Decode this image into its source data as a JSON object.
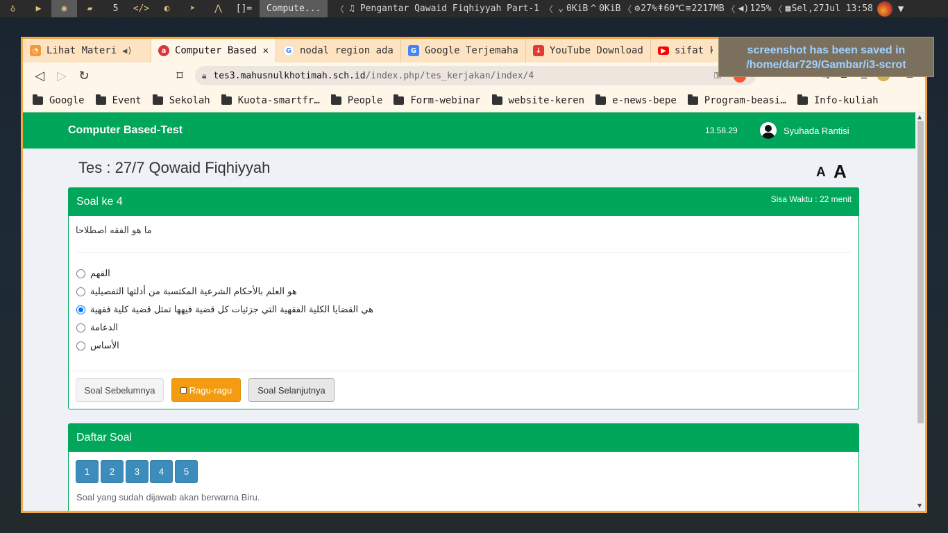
{
  "topbar": {
    "workspaces": [
      "5"
    ],
    "window_title": "Compute...",
    "media": "Pengantar Qawaid Fiqhiyyah Part-1",
    "net_down": "0KiB",
    "net_up": "0KiB",
    "cpu": "27%",
    "temp": "60℃",
    "mem": "2217MB",
    "volume": "125%",
    "date": "Sel,27Jul 13:58",
    "icons": [
      "bell-icon",
      "play-icon",
      "browser-icon",
      "folder-icon",
      "code-icon",
      "firefox-icon",
      "telegram-icon",
      "inkscape-icon",
      "terminal-icon"
    ]
  },
  "tabs": [
    {
      "label": "Lihat Materi",
      "favicon": "#f29a38",
      "audio": true
    },
    {
      "label": "Computer Based-Test",
      "favicon": "#d9363e",
      "active": true
    },
    {
      "label": "nodal region adalah",
      "favicon": "#4285f4"
    },
    {
      "label": "Google Terjemahan",
      "favicon": "#4285f4"
    },
    {
      "label": "YouTube Downloader",
      "favicon": "#e53935"
    },
    {
      "label": "sifat ko",
      "favicon": "#ff0000"
    }
  ],
  "url": {
    "host": "tes3.mahusnulkhotimah.sch.id",
    "path": "/index.php/tes_kerjakan/index/4"
  },
  "bookmarks": [
    "Google",
    "Event",
    "Sekolah",
    "Kuota-smartfr…",
    "People",
    "Form-webinar",
    "website-keren",
    "e-news-bepe",
    "Program-beasi…",
    "Info-kuliah"
  ],
  "app": {
    "brand": "Computer Based-Test",
    "clock": "13.58.29",
    "user": "Syuhada Rantisi"
  },
  "test": {
    "title": "Tes : 27/7 Qowaid Fiqhiyyah",
    "font_small": "A",
    "font_large": "A"
  },
  "question": {
    "heading": "Soal ke 4",
    "timer": "Sisa Waktu : 22 menit",
    "text": "ما هو الفقه اصطلاحا",
    "options": [
      {
        "label": "الفهم",
        "checked": false
      },
      {
        "label": "هو العلم بالأحكام الشرعية المكتسبة من أدلتها التفصيلية",
        "checked": false
      },
      {
        "label": "هي القضايا الكلية الفقهية التي جزئيات كل قضية فيهها تمثل قضية كلية فقهية",
        "checked": true
      },
      {
        "label": "الدعامة",
        "checked": false
      },
      {
        "label": "الأساس",
        "checked": false
      }
    ],
    "buttons": {
      "prev": "Soal Sebelumnya",
      "doubt": "Ragu-ragu",
      "next": "Soal Selanjutnya"
    }
  },
  "question_list": {
    "heading": "Daftar Soal",
    "numbers": [
      "1",
      "2",
      "3",
      "4",
      "5"
    ],
    "note": "Soal yang sudah dijawab akan berwarna Biru."
  },
  "notification": {
    "text": "screenshot has been saved in /home/dar729/Gambar/i3-scrot"
  },
  "colors": {
    "header_green": "#00a65a",
    "answered_blue": "#3c8dbc",
    "doubt_orange": "#f39c12",
    "window_border": "#f5a742"
  }
}
